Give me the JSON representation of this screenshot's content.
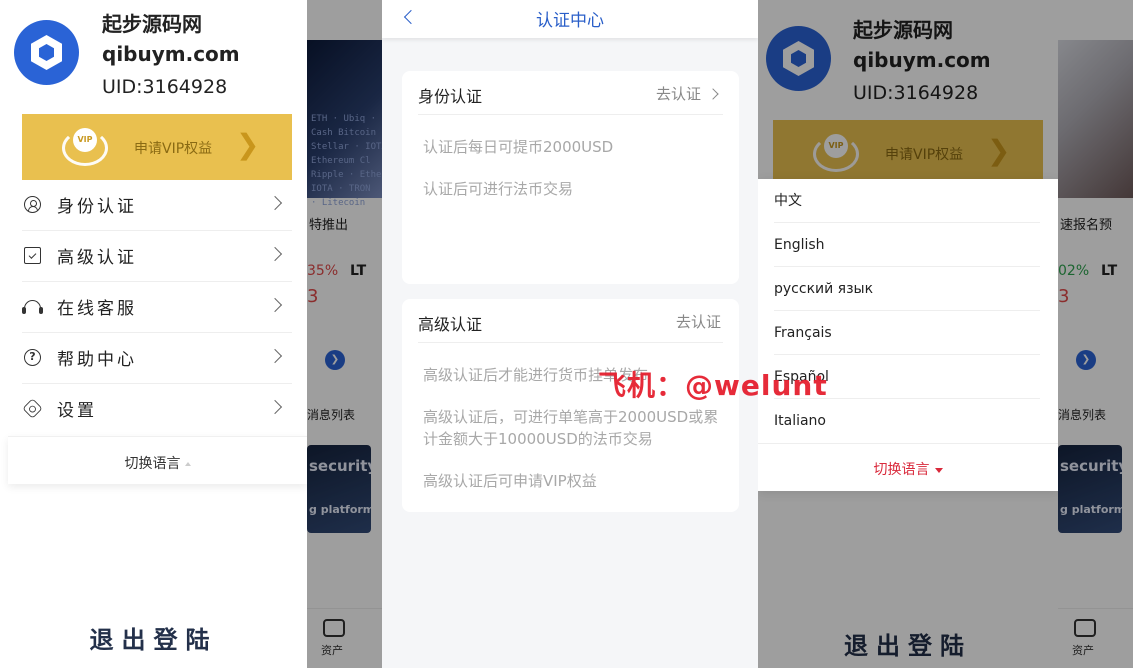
{
  "profile": {
    "name": "起步源码网",
    "domain": "qibuym.com",
    "uid": "UID:3164928"
  },
  "vip": {
    "label": "申请VIP权益",
    "badge_text": "VIP",
    "arrow": "❯"
  },
  "menu": {
    "items": [
      {
        "label": "身份认证",
        "icon": "person-icon"
      },
      {
        "label": "高级认证",
        "icon": "certificate-icon"
      },
      {
        "label": "在线客服",
        "icon": "headset-icon"
      },
      {
        "label": "帮助中心",
        "icon": "question-icon"
      },
      {
        "label": "设置",
        "icon": "gear-icon"
      }
    ]
  },
  "lang_switch_label": "切换语言",
  "logout_label": "退出登陆",
  "languages": [
    "中文",
    "English",
    "русский язык",
    "Français",
    "Español",
    "Italiano"
  ],
  "auth": {
    "title": "认证中心",
    "identity": {
      "title": "身份认证",
      "action": "去认证",
      "lines": [
        "认证后每日可提币2000USD",
        "认证后可进行法币交易"
      ]
    },
    "advanced": {
      "title": "高级认证",
      "action": "去认证",
      "lines": [
        "高级认证后才能进行货币挂单发布",
        "高级认证后，可进行单笔高于2000USD或累计金额大于10000USD的法币交易",
        "高级认证后可申请VIP权益"
      ]
    }
  },
  "background": {
    "caption_left": "特推出",
    "caption_right": "速报名预",
    "pct_left": "35%",
    "pct_right": "02%",
    "ticker": "LT",
    "red_mark": "3",
    "news_list": "消息列表",
    "security_title": "security",
    "security_sub": "g platform",
    "tab_asset": "资产",
    "banner_text": "ETH · Ubiq · Lisk\nCash Bitcoin · NEM\nStellar · IOTA · Et\nEthereum Cl\nRipple · Ethere\nIOTA · TRON\n· Litecoin"
  },
  "watermark": "飞机：@welunt",
  "colors": {
    "brand_blue": "#2a63d6",
    "vip_gold": "#e9c04f",
    "accent_red": "#d9293b",
    "title_blue": "#2a5fc9"
  }
}
